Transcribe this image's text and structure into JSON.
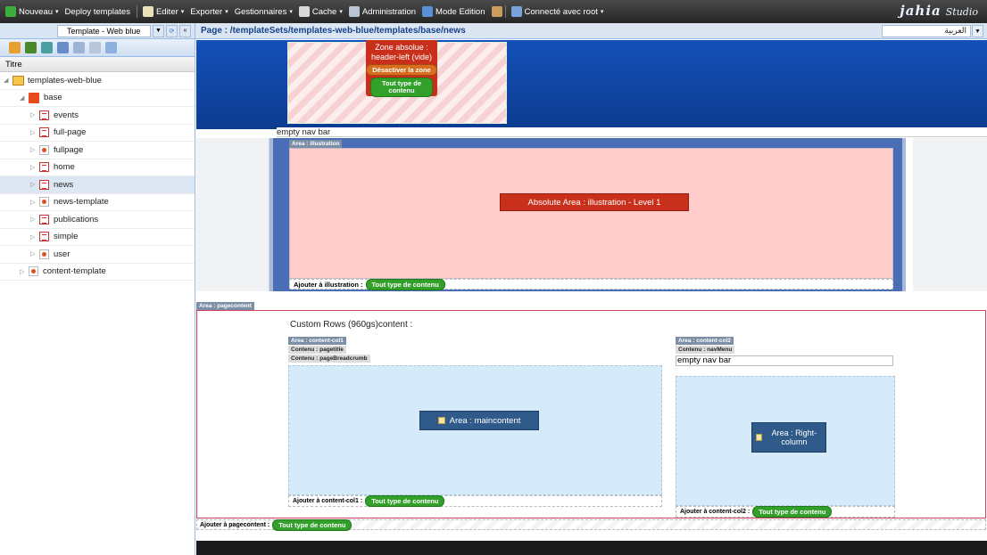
{
  "toolbar": {
    "new_label": "Nouveau",
    "deploy_label": "Deploy templates",
    "edit_label": "Editer",
    "export_label": "Exporter",
    "managers_label": "Gestionnaires",
    "cache_label": "Cache",
    "admin_label": "Administration",
    "mode_label": "Mode Edition",
    "connected_label": "Connecté avec root",
    "brand": "jahia",
    "brand_suffix": "Studio"
  },
  "sidebar": {
    "template_select": "Template - Web blue",
    "column_title": "Titre",
    "tree": {
      "root": "templates-web-blue",
      "base": "base",
      "children": [
        "events",
        "full-page",
        "fullpage",
        "home",
        "news",
        "news-template",
        "publications",
        "simple",
        "user"
      ],
      "other": "content-template"
    }
  },
  "page": {
    "path": "Page : /templateSets/templates-web-blue/templates/base/news",
    "language": "العربية"
  },
  "canvas": {
    "zone_title_1": "Zone absolue :",
    "zone_title_2": "header-left (vide)",
    "zone_deactivate": "Désactiver la zone",
    "zone_any_content": "Tout type de contenu",
    "empty_nav_bar": "empty nav bar",
    "illustration_tag": "Area : illustration",
    "absolute_area_label": "Absolute Area : illustration - Level 1",
    "illustration_add_label": "Ajouter à illustration :",
    "any_content": "Tout type de contenu",
    "pagecontent_tag": "Area : pagecontent",
    "custom_rows_title": "Custom Rows (960gs)content :",
    "col1_tag": "Area : content-col1",
    "col1_content_1": "Contenu : pagetitle",
    "col1_content_2": "Contenu : pageBreadcrumb",
    "maincontent_label": "Area : maincontent",
    "col1_add_label": "Ajouter à content-col1 :",
    "col2_tag": "Area : content-col2",
    "col2_content_1": "Contenu : navMenu",
    "col2_nav_text": "empty nav bar",
    "right_column_label": "Area : Right-column",
    "col2_add_label": "Ajouter à content-col2 :",
    "pagecontent_add_label": "Ajouter à pagecontent :"
  }
}
